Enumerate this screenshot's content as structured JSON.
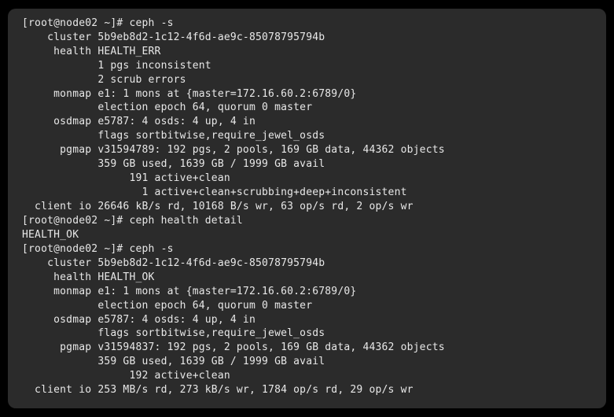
{
  "lines": [
    "[root@node02 ~]# ceph -s",
    "    cluster 5b9eb8d2-1c12-4f6d-ae9c-85078795794b",
    "     health HEALTH_ERR",
    "            1 pgs inconsistent",
    "            2 scrub errors",
    "     monmap e1: 1 mons at {master=172.16.60.2:6789/0}",
    "            election epoch 64, quorum 0 master",
    "     osdmap e5787: 4 osds: 4 up, 4 in",
    "            flags sortbitwise,require_jewel_osds",
    "      pgmap v31594789: 192 pgs, 2 pools, 169 GB data, 44362 objects",
    "            359 GB used, 1639 GB / 1999 GB avail",
    "                 191 active+clean",
    "                   1 active+clean+scrubbing+deep+inconsistent",
    "  client io 26646 kB/s rd, 10168 B/s wr, 63 op/s rd, 2 op/s wr",
    "[root@node02 ~]# ceph health detail",
    "HEALTH_OK",
    "[root@node02 ~]# ceph -s",
    "    cluster 5b9eb8d2-1c12-4f6d-ae9c-85078795794b",
    "     health HEALTH_OK",
    "     monmap e1: 1 mons at {master=172.16.60.2:6789/0}",
    "            election epoch 64, quorum 0 master",
    "     osdmap e5787: 4 osds: 4 up, 4 in",
    "            flags sortbitwise,require_jewel_osds",
    "      pgmap v31594837: 192 pgs, 2 pools, 169 GB data, 44362 objects",
    "            359 GB used, 1639 GB / 1999 GB avail",
    "                 192 active+clean",
    "  client io 253 MB/s rd, 273 kB/s wr, 1784 op/s rd, 29 op/s wr"
  ]
}
